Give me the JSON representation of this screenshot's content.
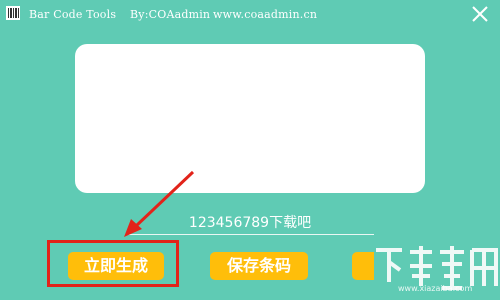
{
  "window": {
    "app_name": "Bar Code Tools",
    "author": "By:COAadmin",
    "website": "www.coaadmin.cn",
    "icon": "barcode-icon",
    "close_icon": "close-icon"
  },
  "preview": {
    "background": "#ffffff"
  },
  "input": {
    "value": "123456789下载吧"
  },
  "buttons": {
    "generate_label": "立即生成",
    "save_label": "保存条码"
  },
  "annotation": {
    "highlight_color": "#e2231a"
  },
  "watermark": {
    "text": "www.xiazaiba.com"
  },
  "colors": {
    "background": "#5fcbb4",
    "button": "#ffbe0a"
  }
}
